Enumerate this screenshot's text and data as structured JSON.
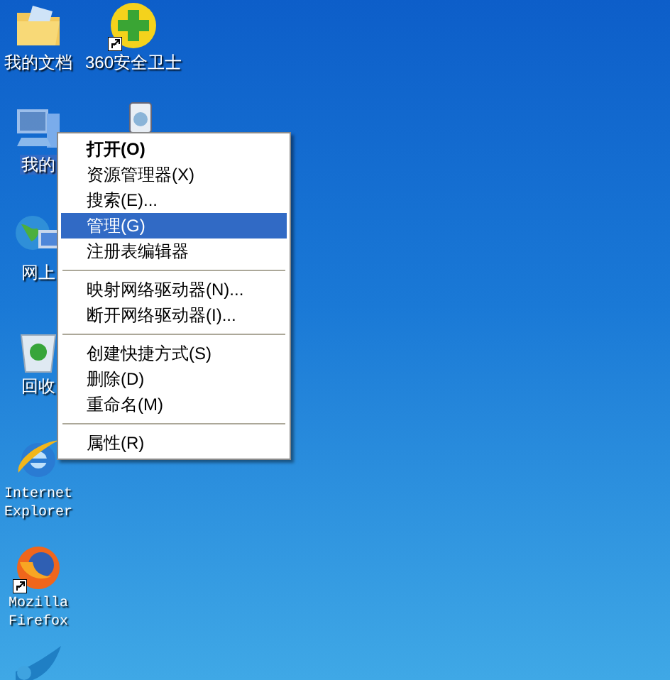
{
  "desktop_icons": [
    {
      "kind": "documents",
      "label": "我的文档",
      "selected": false,
      "shortcut": false
    },
    {
      "kind": "app360",
      "label": "360安全卫士",
      "selected": false,
      "shortcut": true
    },
    {
      "kind": "computer",
      "label": "我的",
      "selected": true,
      "shortcut": false
    },
    {
      "kind": "device",
      "selected": false
    },
    {
      "kind": "network",
      "label": "网上",
      "selected": false,
      "shortcut": false
    },
    {
      "kind": "recycle",
      "label": "回收",
      "selected": false,
      "shortcut": false
    },
    {
      "kind": "ie",
      "label": "Internet Explorer",
      "selected": false,
      "shortcut": false
    },
    {
      "kind": "firefox",
      "label": "Mozilla Firefox",
      "selected": false,
      "shortcut": true
    },
    {
      "kind": "bird",
      "selected": false
    }
  ],
  "context_menu": {
    "groups": [
      [
        {
          "label": "打开(O)",
          "default": true,
          "selected": false
        },
        {
          "label": "资源管理器(X)",
          "default": false,
          "selected": false
        },
        {
          "label": "搜索(E)...",
          "default": false,
          "selected": false
        },
        {
          "label": "管理(G)",
          "default": false,
          "selected": true
        },
        {
          "label": "注册表编辑器",
          "default": false,
          "selected": false
        }
      ],
      [
        {
          "label": "映射网络驱动器(N)...",
          "default": false,
          "selected": false
        },
        {
          "label": "断开网络驱动器(I)...",
          "default": false,
          "selected": false
        }
      ],
      [
        {
          "label": "创建快捷方式(S)",
          "default": false,
          "selected": false
        },
        {
          "label": "删除(D)",
          "default": false,
          "selected": false
        },
        {
          "label": "重命名(M)",
          "default": false,
          "selected": false
        }
      ],
      [
        {
          "label": "属性(R)",
          "default": false,
          "selected": false
        }
      ]
    ]
  }
}
